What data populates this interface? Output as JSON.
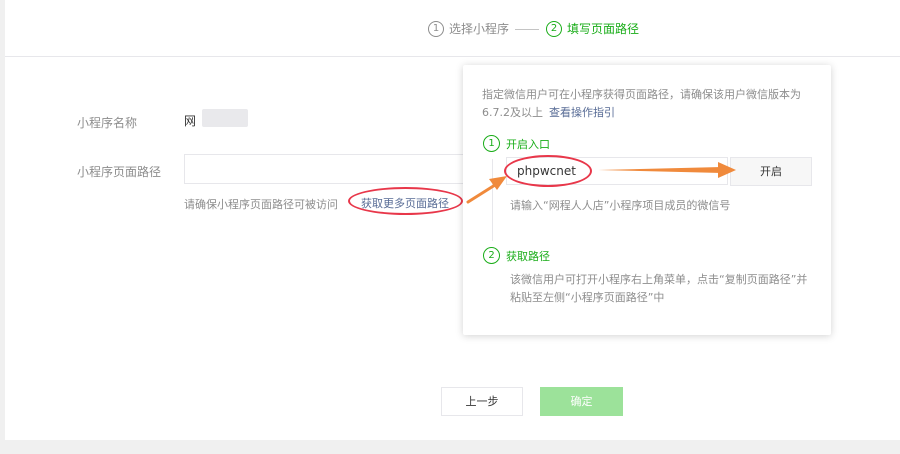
{
  "steps": [
    {
      "num": "1",
      "label": "选择小程序"
    },
    {
      "num": "2",
      "label": "填写页面路径"
    }
  ],
  "form": {
    "name_label": "小程序名称",
    "name_value": "网",
    "path_label": "小程序页面路径",
    "path_value": "",
    "hint": "请确保小程序页面路径可被访问",
    "more_link": "获取更多页面路径"
  },
  "popover": {
    "desc": "指定微信用户可在小程序获得页面路径，请确保该用户微信版本为6.7.2及以上",
    "guide_link": "查看操作指引",
    "step1": {
      "num": "1",
      "title": "开启入口"
    },
    "wechat_input_value": "phpwcnet",
    "open_button": "开启",
    "input_note": "请输入“网程人人店”小程序项目成员的微信号",
    "step2": {
      "num": "2",
      "title": "获取路径"
    },
    "step2_note": "该微信用户可打开小程序右上角菜单，点击“复制页面路径”并粘贴至左侧“小程序页面路径”中"
  },
  "footer": {
    "prev_button": "上一步",
    "ok_button": "确定"
  },
  "colors": {
    "accent_green": "#1aad19",
    "link_blue": "#576b95",
    "annotation_red": "#e8374a",
    "annotation_orange": "#f08a3c"
  }
}
